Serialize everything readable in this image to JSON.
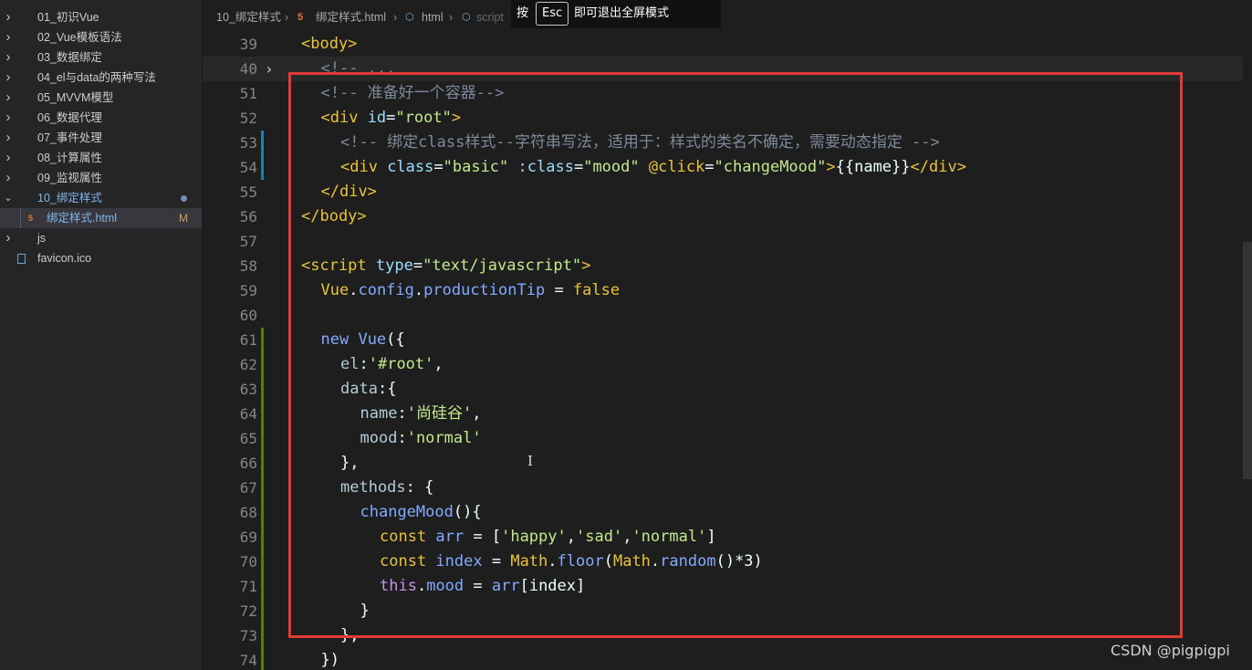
{
  "explorer": {
    "items": [
      {
        "label": "01_初识Vue",
        "type": "folder"
      },
      {
        "label": "02_Vue模板语法",
        "type": "folder"
      },
      {
        "label": "03_数据绑定",
        "type": "folder"
      },
      {
        "label": "04_el与data的两种写法",
        "type": "folder"
      },
      {
        "label": "05_MVVM模型",
        "type": "folder"
      },
      {
        "label": "06_数据代理",
        "type": "folder"
      },
      {
        "label": "07_事件处理",
        "type": "folder"
      },
      {
        "label": "08_计算属性",
        "type": "folder"
      },
      {
        "label": "09_监视属性",
        "type": "folder"
      },
      {
        "label": "10_绑定样式",
        "type": "folder-open"
      },
      {
        "label": "绑定样式.html",
        "type": "html-file",
        "badge": "M"
      },
      {
        "label": "js",
        "type": "folder"
      },
      {
        "label": "favicon.ico",
        "type": "file"
      }
    ]
  },
  "breadcrumb": {
    "folder": "10_绑定样式",
    "file": "绑定样式.html",
    "node1": "html",
    "node2": "script"
  },
  "fullscreen_banner": {
    "press": "按",
    "key": "Esc",
    "message": "即可退出全屏模式"
  },
  "editor": {
    "lines": [
      {
        "num": "39",
        "tokens": [
          [
            "t-tag",
            "<body>"
          ]
        ],
        "indent": 0
      },
      {
        "num": "40",
        "tokens": [
          [
            "t-cmt",
            "<!-- ..."
          ]
        ],
        "indent": 1,
        "folded": true,
        "highlight": true
      },
      {
        "num": "51",
        "tokens": [
          [
            "t-cmt",
            "<!-- 准备好一个容器-->"
          ]
        ],
        "indent": 1
      },
      {
        "num": "52",
        "tokens": [
          [
            "t-tag",
            "<div "
          ],
          [
            "t-attr",
            "id"
          ],
          [
            "t-punc",
            "="
          ],
          [
            "t-str",
            "\"root\""
          ],
          [
            "t-tag",
            ">"
          ]
        ],
        "indent": 1
      },
      {
        "num": "53",
        "tokens": [
          [
            "t-cmt",
            "<!-- 绑定class样式--字符串写法，适用于：样式的类名不确定，需要动态指定 -->"
          ]
        ],
        "indent": 2,
        "mark": "blue"
      },
      {
        "num": "54",
        "tokens": [
          [
            "t-tag",
            "<div "
          ],
          [
            "t-attr",
            "class"
          ],
          [
            "t-punc",
            "="
          ],
          [
            "t-str",
            "\"basic\""
          ],
          [
            "t-punc",
            " "
          ],
          [
            "t-attr",
            ":class"
          ],
          [
            "t-punc",
            "="
          ],
          [
            "t-str",
            "\"mood\""
          ],
          [
            "t-punc",
            " "
          ],
          [
            "t-kw",
            "@click"
          ],
          [
            "t-punc",
            "="
          ],
          [
            "t-str",
            "\"changeMood\""
          ],
          [
            "t-tag",
            ">"
          ],
          [
            "t-punc",
            "{{name}}"
          ],
          [
            "t-tag",
            "</div>"
          ]
        ],
        "indent": 2,
        "mark": "blue"
      },
      {
        "num": "55",
        "tokens": [
          [
            "t-tag",
            "</div>"
          ]
        ],
        "indent": 1
      },
      {
        "num": "56",
        "tokens": [
          [
            "t-tag",
            "</body>"
          ]
        ],
        "indent": 0
      },
      {
        "num": "57",
        "tokens": [],
        "indent": 0
      },
      {
        "num": "58",
        "tokens": [
          [
            "t-tag",
            "<script "
          ],
          [
            "t-attr",
            "type"
          ],
          [
            "t-punc",
            "="
          ],
          [
            "t-str",
            "\"text/javascript\""
          ],
          [
            "t-tag",
            ">"
          ]
        ],
        "indent": 0
      },
      {
        "num": "59",
        "tokens": [
          [
            "t-kw",
            "Vue"
          ],
          [
            "t-punc",
            "."
          ],
          [
            "t-fn",
            "config"
          ],
          [
            "t-punc",
            "."
          ],
          [
            "t-fn",
            "productionTip"
          ],
          [
            "t-punc",
            " = "
          ],
          [
            "t-kw",
            "false"
          ]
        ],
        "indent": 1
      },
      {
        "num": "60",
        "tokens": [],
        "indent": 0
      },
      {
        "num": "61",
        "tokens": [
          [
            "t-fn",
            "new "
          ],
          [
            "t-fn",
            "Vue"
          ],
          [
            "t-punc",
            "({"
          ]
        ],
        "indent": 1,
        "mark": "green"
      },
      {
        "num": "62",
        "tokens": [
          [
            "t-key",
            "el"
          ],
          [
            "t-punc",
            ":"
          ],
          [
            "t-str",
            "'#root'"
          ],
          [
            "t-punc",
            ","
          ]
        ],
        "indent": 2,
        "mark": "green"
      },
      {
        "num": "63",
        "tokens": [
          [
            "t-key",
            "data"
          ],
          [
            "t-punc",
            ":{"
          ]
        ],
        "indent": 2,
        "mark": "green"
      },
      {
        "num": "64",
        "tokens": [
          [
            "t-key",
            "name"
          ],
          [
            "t-punc",
            ":"
          ],
          [
            "t-str",
            "'尚硅谷'"
          ],
          [
            "t-punc",
            ","
          ]
        ],
        "indent": 3,
        "mark": "green"
      },
      {
        "num": "65",
        "tokens": [
          [
            "t-key",
            "mood"
          ],
          [
            "t-punc",
            ":"
          ],
          [
            "t-str",
            "'normal'"
          ]
        ],
        "indent": 3,
        "mark": "green"
      },
      {
        "num": "66",
        "tokens": [
          [
            "t-punc",
            "},"
          ]
        ],
        "indent": 2,
        "mark": "green"
      },
      {
        "num": "67",
        "tokens": [
          [
            "t-key",
            "methods"
          ],
          [
            "t-punc",
            ": {"
          ]
        ],
        "indent": 2,
        "mark": "green"
      },
      {
        "num": "68",
        "tokens": [
          [
            "t-fn",
            "changeMood"
          ],
          [
            "t-punc",
            "(){"
          ]
        ],
        "indent": 3,
        "mark": "green"
      },
      {
        "num": "69",
        "tokens": [
          [
            "t-kw",
            "const "
          ],
          [
            "t-fn",
            "arr"
          ],
          [
            "t-punc",
            " = ["
          ],
          [
            "t-str",
            "'happy'"
          ],
          [
            "t-punc",
            ","
          ],
          [
            "t-str",
            "'sad'"
          ],
          [
            "t-punc",
            ","
          ],
          [
            "t-str",
            "'normal'"
          ],
          [
            "t-punc",
            "]"
          ]
        ],
        "indent": 4,
        "mark": "green"
      },
      {
        "num": "70",
        "tokens": [
          [
            "t-kw",
            "const "
          ],
          [
            "t-fn",
            "index"
          ],
          [
            "t-punc",
            " = "
          ],
          [
            "t-kw",
            "Math"
          ],
          [
            "t-punc",
            "."
          ],
          [
            "t-fn",
            "floor"
          ],
          [
            "t-punc",
            "("
          ],
          [
            "t-kw",
            "Math"
          ],
          [
            "t-punc",
            "."
          ],
          [
            "t-fn",
            "random"
          ],
          [
            "t-punc",
            "()*3)"
          ]
        ],
        "indent": 4,
        "mark": "green"
      },
      {
        "num": "71",
        "tokens": [
          [
            "t-kw2",
            "this"
          ],
          [
            "t-punc",
            "."
          ],
          [
            "t-fn",
            "mood"
          ],
          [
            "t-punc",
            " = "
          ],
          [
            "t-fn",
            "arr"
          ],
          [
            "t-punc",
            "[index]"
          ]
        ],
        "indent": 4,
        "mark": "green"
      },
      {
        "num": "72",
        "tokens": [
          [
            "t-punc",
            "}"
          ]
        ],
        "indent": 3,
        "mark": "green"
      },
      {
        "num": "73",
        "tokens": [
          [
            "t-punc",
            "},"
          ]
        ],
        "indent": 2,
        "mark": "green"
      },
      {
        "num": "74",
        "tokens": [
          [
            "t-punc",
            "})"
          ]
        ],
        "indent": 1,
        "mark": "green"
      }
    ]
  },
  "watermark": "CSDN @pigpigpi",
  "colors": {
    "annotation_box": "#e53935",
    "sidebar_bg": "#252526",
    "editor_bg": "#1e1e1e"
  }
}
